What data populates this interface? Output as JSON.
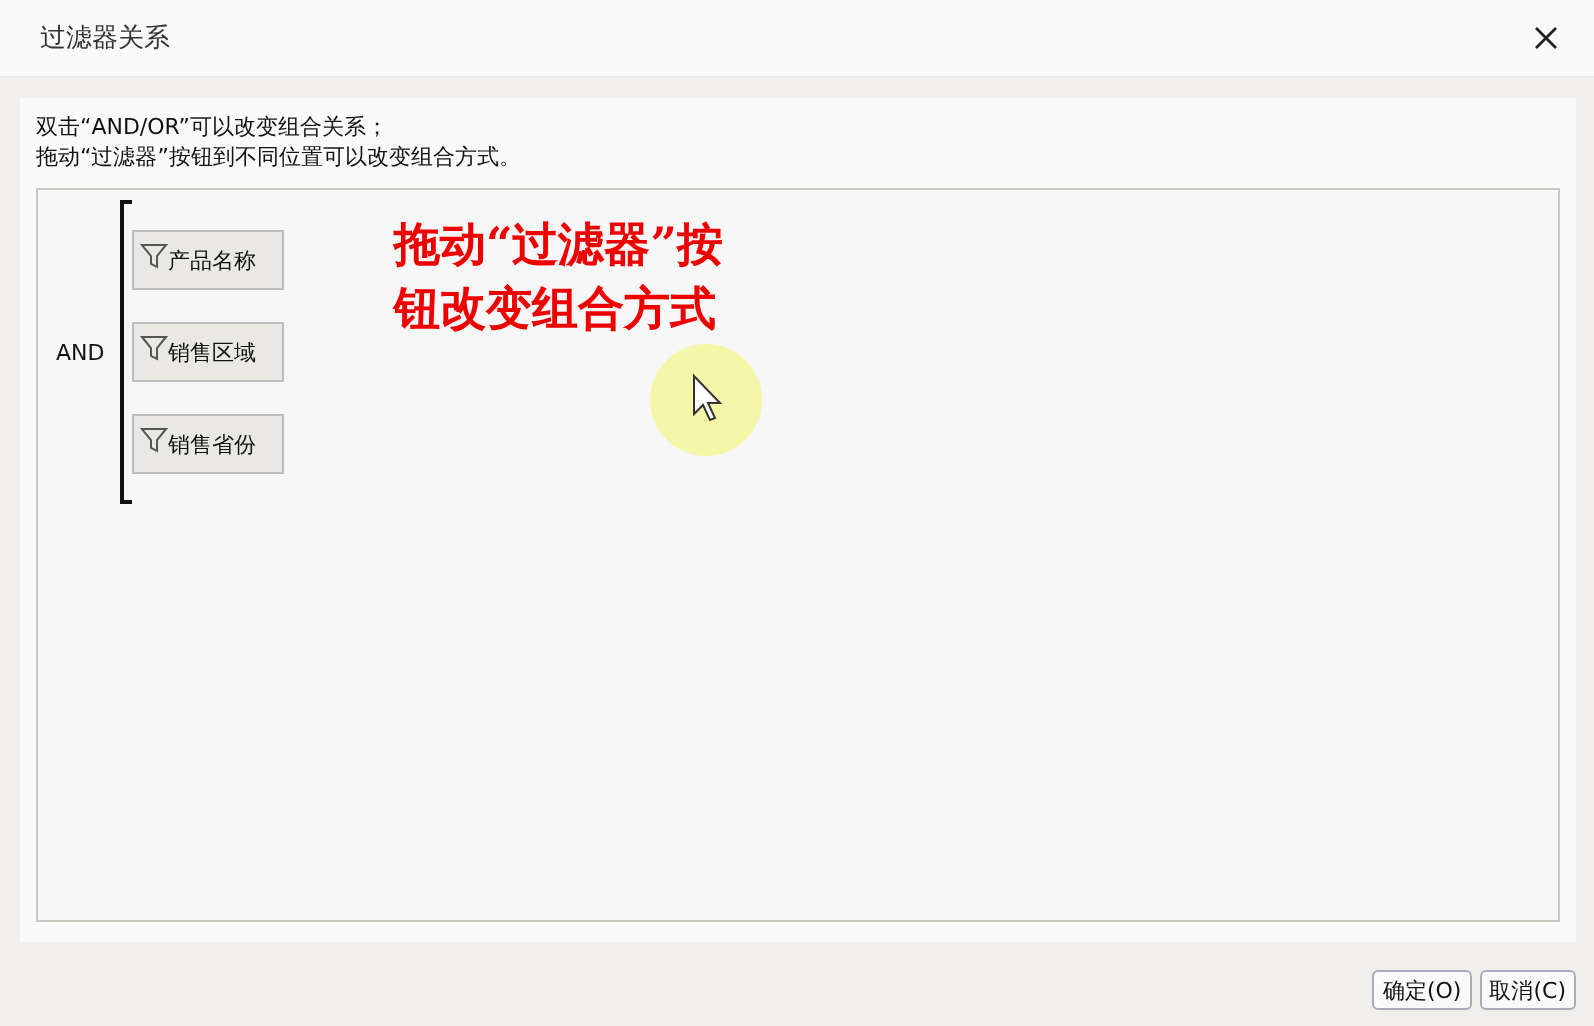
{
  "window": {
    "title": "过滤器关系"
  },
  "instructions": [
    "双击“AND/OR”可以改变组合关系；",
    "拖动“过滤器”按钮到不同位置可以改变组合方式。"
  ],
  "group": {
    "operator": "AND",
    "filters": [
      {
        "label": "产品名称"
      },
      {
        "label": "销售区域"
      },
      {
        "label": "销售省份"
      }
    ]
  },
  "annotation": [
    "拖动“过滤器”按",
    "钮改变组合方式"
  ],
  "buttons": [
    "确定(O)",
    "取消(C)"
  ]
}
